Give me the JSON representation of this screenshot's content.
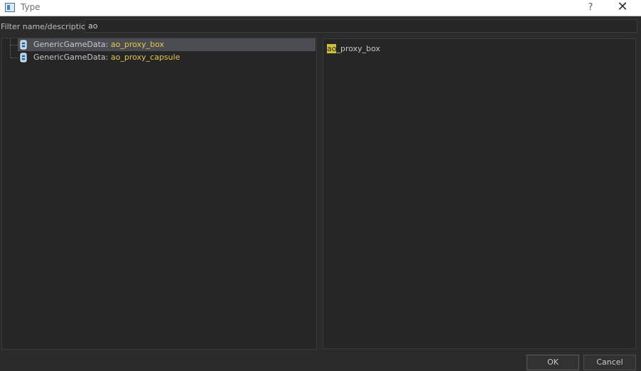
{
  "window": {
    "title": "Type",
    "help_label": "?",
    "close_label": "✕"
  },
  "filter": {
    "label": "Filter name/description:",
    "value": "ao"
  },
  "tree": {
    "items": [
      {
        "prefix": "GenericGameData: ",
        "match": "ao",
        "rest": "_proxy_box",
        "selected": true
      },
      {
        "prefix": "GenericGameData: ",
        "match": "ao",
        "rest": "_proxy_capsule",
        "selected": false
      }
    ]
  },
  "preview": {
    "match": "ao",
    "rest": "_proxy_box"
  },
  "buttons": {
    "ok_label": "OK",
    "cancel_label": "Cancel"
  },
  "colors": {
    "highlight": "#e5c84a",
    "selection": "#4a4d52"
  }
}
